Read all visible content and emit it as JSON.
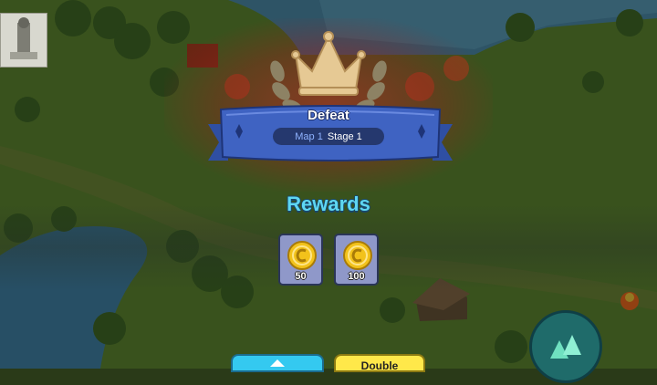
{
  "result": {
    "title": "Defeat",
    "map_label": "Map 1",
    "stage_label": "Stage 1"
  },
  "rewards": {
    "title": "Rewards",
    "items": [
      {
        "icon": "gold-coin-icon",
        "amount": "50"
      },
      {
        "icon": "gold-coin-icon",
        "amount": "100"
      }
    ]
  },
  "buttons": {
    "double_label": "Double"
  },
  "colors": {
    "banner_blue": "#3f63c2",
    "rewards_title": "#5ed7f2",
    "reward_tile": "#8f98c9",
    "coin_gold": "#f2c21b",
    "button_cyan": "#34c9f0",
    "button_yellow": "#ffe84a"
  }
}
